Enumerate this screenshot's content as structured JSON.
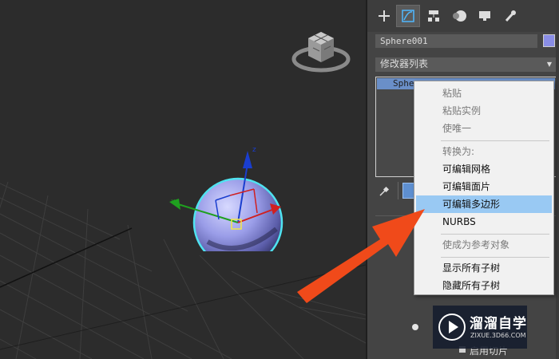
{
  "object_name": "Sphere001",
  "object_color": "#8a8ee6",
  "modifier_list_label": "修改器列表",
  "stack_item": "Sphere",
  "viewport": {
    "axis_z": "z",
    "axis_x": "x"
  },
  "context_menu": {
    "items": [
      {
        "label": "粘贴",
        "enabled": false
      },
      {
        "label": "粘贴实例",
        "enabled": false
      },
      {
        "label": "使唯一",
        "enabled": false
      },
      {
        "label": "转换为:",
        "enabled": false
      },
      {
        "label": "可编辑网格",
        "enabled": true
      },
      {
        "label": "可编辑面片",
        "enabled": true
      },
      {
        "label": "可编辑多边形",
        "enabled": true,
        "highlighted": true
      },
      {
        "label": "NURBS",
        "enabled": true
      },
      {
        "label": "使成为参考对象",
        "enabled": false
      },
      {
        "label": "显示所有子树",
        "enabled": true
      },
      {
        "label": "隐藏所有子树",
        "enabled": true
      }
    ]
  },
  "panel_bottom_label": "启用切片",
  "watermark": {
    "title": "溜溜自学",
    "url": "ZIXUE.3D66.COM"
  },
  "colors": {
    "highlight": "#99c9f3",
    "arrow": "#f04a1a",
    "selection": "#4fe3f0"
  }
}
